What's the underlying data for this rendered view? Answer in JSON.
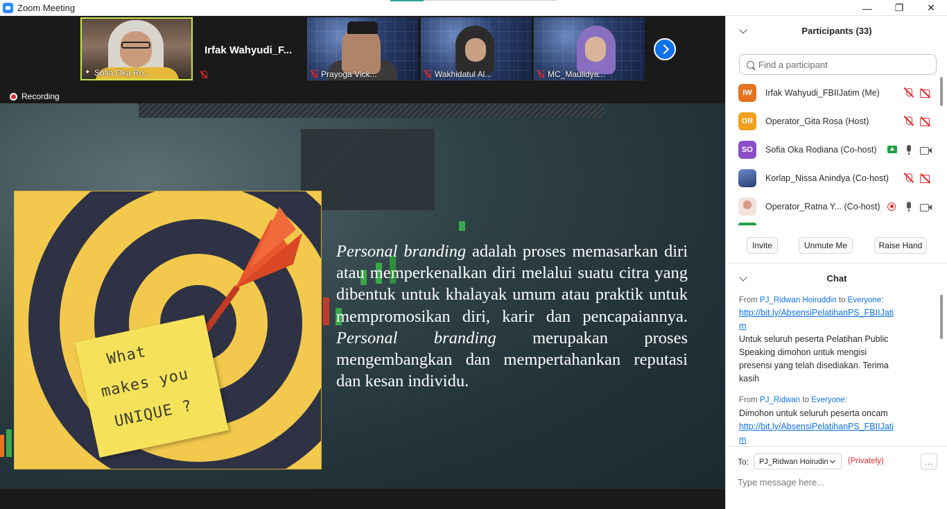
{
  "window": {
    "title": "Zoom Meeting",
    "controls": [
      "—",
      "❐",
      "✕"
    ]
  },
  "video_strip": {
    "tiles": [
      {
        "name": "Sofia Oka Ro..."
      },
      {
        "name": "Irfak  Wahyudi_F..."
      },
      {
        "name": "Prayoga Vick..."
      },
      {
        "name": "Wakhidatul Al..."
      },
      {
        "name": "MC_Maulidya..."
      }
    ],
    "next_icon": "chevron-right-icon"
  },
  "recording": {
    "label": "Recording"
  },
  "slide": {
    "note_lines": [
      "What",
      "makes you",
      "UNIQUE ?"
    ],
    "paragraph": {
      "p1_em": "Personal branding",
      "p1_rest": " adalah proses memasarkan diri atau memperkenalkan diri melalui suatu citra yang dibentuk untuk khalayak umum atau praktik untuk mempromosikan diri, karir dan pencapaiannya. ",
      "p2_em": "Personal branding",
      "p2_rest": " merupakan proses mengembangkan dan mempertahankan reputasi dan kesan individu."
    }
  },
  "participants": {
    "title": "Participants (33)",
    "search_placeholder": "Find a participant",
    "list": [
      {
        "initials": "IW",
        "name": "Irfak Wahyudi_FBIIJatim (Me)",
        "color": "#e5731f",
        "mic": "muted",
        "video": "muted"
      },
      {
        "initials": "OR",
        "name": "Operator_Gita Rosa (Host)",
        "color": "#f2a01f",
        "mic": "muted",
        "video": "muted"
      },
      {
        "initials": "SO",
        "name": "Sofia Oka Rodiana (Co-host)",
        "color": "#8a4fc7",
        "mic": "on",
        "video": "on"
      },
      {
        "initials": "",
        "name": "Korlap_Nissa Anindya (Co-host)",
        "color": "#3a5a9a",
        "mic": "muted",
        "video": "muted"
      },
      {
        "initials": "",
        "name": "Operator_Ratna Y... (Co-host)",
        "color": "#e8cfc3",
        "mic": "recording",
        "video": "on"
      }
    ],
    "buttons": {
      "invite": "Invite",
      "unmute_me": "Unmute Me",
      "raise_hand": "Raise Hand"
    }
  },
  "chat": {
    "title": "Chat",
    "messages": [
      {
        "from": "From",
        "sender": "PJ_Ridwan Hoiruddin",
        "to_word": "to",
        "recipient": "Everyone:",
        "lines": [
          "http://bit.ly/AbsensiPelatihanPS_FBIIJati",
          "m",
          "Untuk seluruh peserta Pelatihan Public",
          "Speaking dimohon untuk mengisi",
          "presensi yang telah disediakan. Terima",
          "kasih"
        ]
      },
      {
        "from": "From",
        "sender": "PJ_Ridwan",
        "to_word": "to",
        "recipient": "Everyone:",
        "lines": [
          "Dimohon untuk seluruh peserta oncam",
          "http://bit.ly/AbsensiPelatihanPS_FBIIJati",
          "m"
        ]
      }
    ],
    "to_label": "To:",
    "to_value": "PJ_Ridwan Hoirudin",
    "privately": "(Privately)",
    "more": "...",
    "input_placeholder": "Type message here..."
  }
}
